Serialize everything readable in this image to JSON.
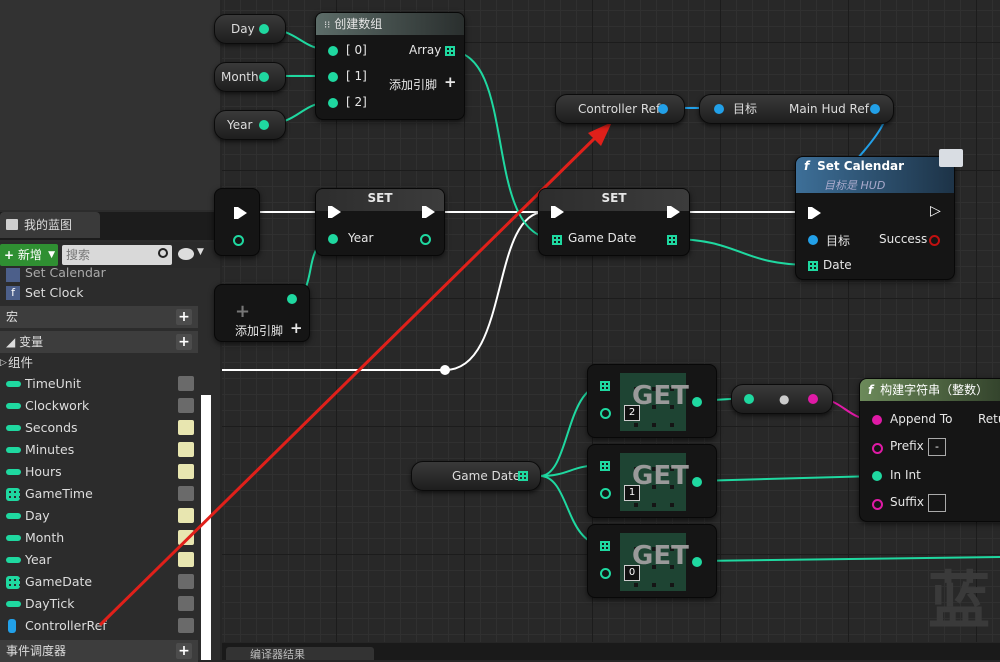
{
  "panel": {
    "tab_label": "我的蓝图",
    "add_label": "新增",
    "search_placeholder": "搜索",
    "funcs_partial": [
      "Set Calendar",
      "Set Clock"
    ],
    "sec_macro": "宏",
    "sec_vars": "变量",
    "group_components": "组件",
    "variables": [
      {
        "name": "TimeUnit",
        "type": "int",
        "eye": "off"
      },
      {
        "name": "Clockwork",
        "type": "int",
        "eye": "off"
      },
      {
        "name": "Seconds",
        "type": "int",
        "eye": "on"
      },
      {
        "name": "Minutes",
        "type": "int",
        "eye": "on"
      },
      {
        "name": "Hours",
        "type": "int",
        "eye": "on"
      },
      {
        "name": "GameTime",
        "type": "array",
        "eye": "off"
      },
      {
        "name": "Day",
        "type": "int",
        "eye": "on"
      },
      {
        "name": "Month",
        "type": "int",
        "eye": "on"
      },
      {
        "name": "Year",
        "type": "int",
        "eye": "on"
      },
      {
        "name": "GameDate",
        "type": "array",
        "eye": "off"
      },
      {
        "name": "DayTick",
        "type": "int",
        "eye": "off"
      },
      {
        "name": "ControllerRef",
        "type": "ref",
        "eye": "off"
      }
    ],
    "sec_dispatch": "事件调度器"
  },
  "graph": {
    "var_day": "Day",
    "var_month": "Month",
    "var_year": "Year",
    "make_array": {
      "title": "创建数组",
      "in0": "[ 0]",
      "in1": "[ 1]",
      "in2": "[ 2]",
      "out": "Array",
      "add_pin": "添加引脚"
    },
    "controller_ref": "Controller Ref",
    "get_main_hud": {
      "target": "目标",
      "out": "Main Hud Ref"
    },
    "set_calendar": {
      "title": "Set Calendar",
      "subtitle": "目标是 HUD",
      "target": "目标",
      "success": "Success",
      "date": "Date"
    },
    "set_year": {
      "title": "SET",
      "pin": "Year"
    },
    "set_gamedate": {
      "title": "SET",
      "pin": "Game Date"
    },
    "add_pin_left": "添加引脚",
    "game_date_var": "Game Date",
    "get_nodes": [
      {
        "label": "GET",
        "index": "2"
      },
      {
        "label": "GET",
        "index": "1"
      },
      {
        "label": "GET",
        "index": "0"
      }
    ],
    "build_string": {
      "title": "构建字符串（整数）",
      "append_to": "Append To",
      "ret": "Retu",
      "prefix": "Prefix",
      "prefix_val": "-",
      "in_int": "In Int",
      "suffix": "Suffix"
    },
    "watermark": "蓝",
    "bottom_tab": "编译器结果"
  },
  "colors": {
    "int": "#1fd8a0",
    "obj": "#22a0e8",
    "string": "#e01aa6",
    "exec": "#ffffff",
    "annotation": "#e0201a"
  }
}
